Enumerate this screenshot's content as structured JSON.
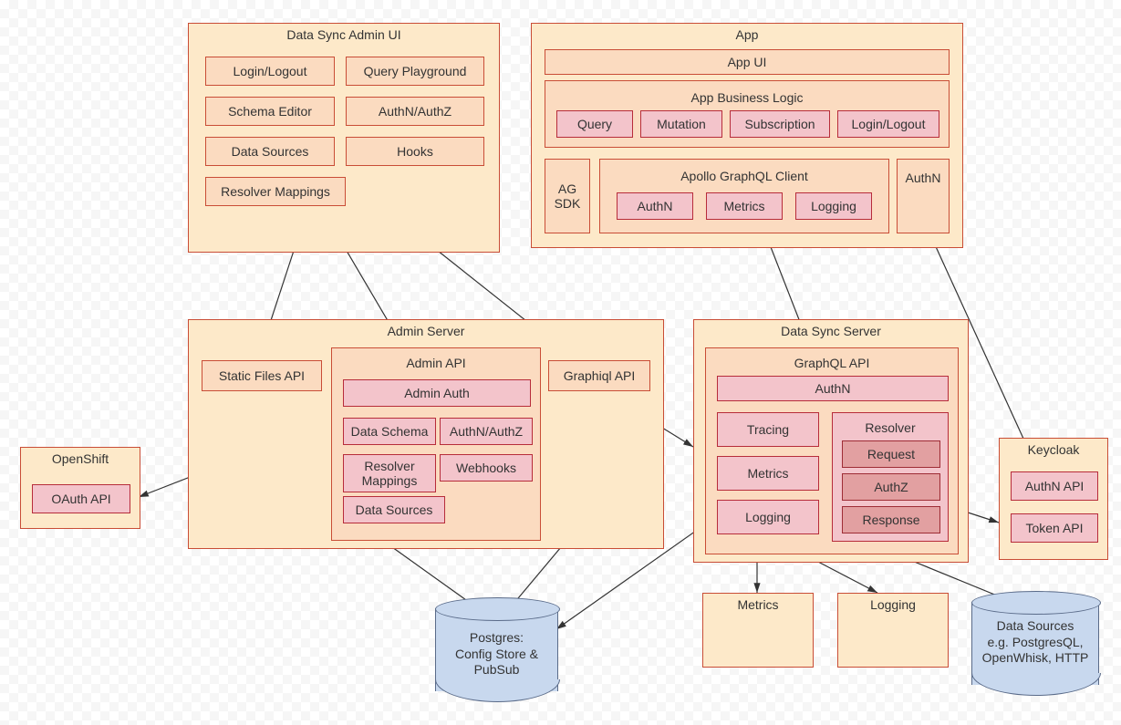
{
  "admin_ui": {
    "title": "Data Sync Admin UI",
    "login": "Login/Logout",
    "query_playground": "Query Playground",
    "schema_editor": "Schema Editor",
    "authnz": "AuthN/AuthZ",
    "data_sources": "Data Sources",
    "hooks": "Hooks",
    "resolver_mappings": "Resolver Mappings"
  },
  "app": {
    "title": "App",
    "app_ui": "App UI",
    "business_logic": {
      "title": "App Business Logic",
      "query": "Query",
      "mutation": "Mutation",
      "subscription": "Subscription",
      "login": "Login/Logout"
    },
    "ag_sdk": "AG\nSDK",
    "apollo": {
      "title": "Apollo GraphQL Client",
      "authn": "AuthN",
      "metrics": "Metrics",
      "logging": "Logging"
    },
    "authn": "AuthN"
  },
  "admin_server": {
    "title": "Admin Server",
    "static_files": "Static Files API",
    "graphiql": "Graphiql API",
    "admin_api": {
      "title": "Admin API",
      "admin_auth": "Admin Auth",
      "data_schema": "Data Schema",
      "authnz": "AuthN/AuthZ",
      "resolver_mappings": "Resolver\nMappings",
      "webhooks": "Webhooks",
      "data_sources": "Data Sources"
    }
  },
  "data_sync_server": {
    "title": "Data Sync Server",
    "graphql_api": {
      "title": "GraphQL API",
      "authn": "AuthN",
      "tracing": "Tracing",
      "metrics": "Metrics",
      "logging": "Logging",
      "resolver": {
        "title": "Resolver",
        "request": "Request",
        "authz": "AuthZ",
        "response": "Response"
      }
    }
  },
  "openshift": {
    "title": "OpenShift",
    "oauth": "OAuth API"
  },
  "keycloak": {
    "title": "Keycloak",
    "authn_api": "AuthN API",
    "token_api": "Token API"
  },
  "metrics_sink": "Metrics",
  "logging_sink": "Logging",
  "postgres": "Postgres:\nConfig Store &\nPubSub",
  "data_sources_db": "Data Sources\ne.g. PostgresQL,\nOpenWhisk, HTTP"
}
